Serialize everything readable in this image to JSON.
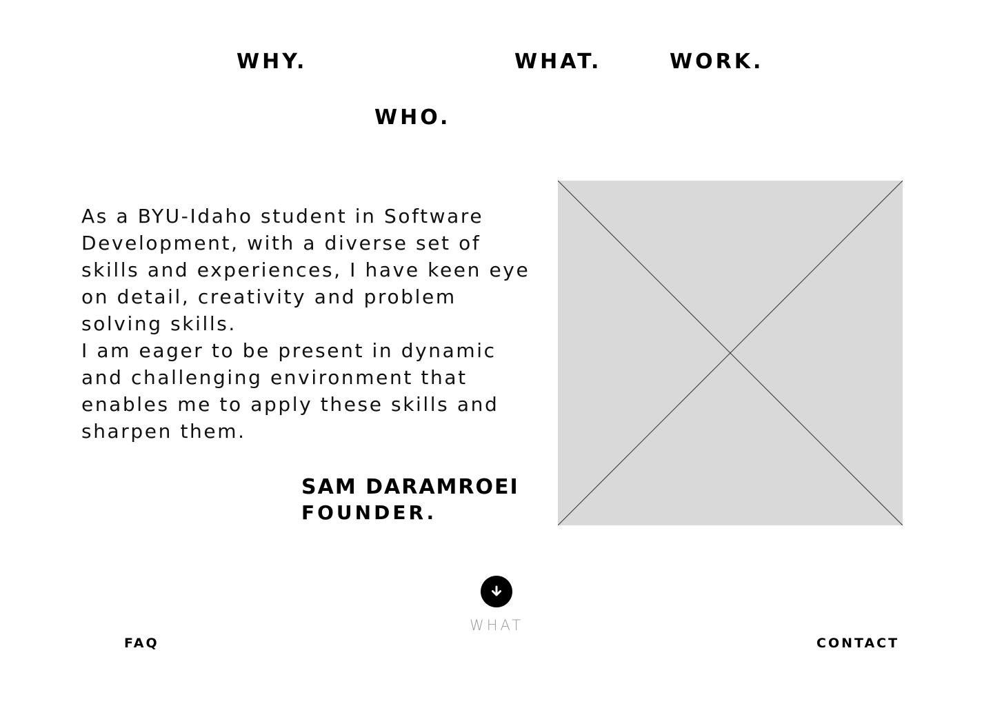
{
  "nav": {
    "why": "WHY.",
    "what": "WHAT.",
    "work": "WORK.",
    "who": "WHO."
  },
  "bio": {
    "paragraph_1": "As a BYU-Idaho student in Software Development, with a diverse set of skills and experiences, I have keen eye on detail, creativity and problem solving skills.",
    "paragraph_2": "I am eager to be present in dynamic and challenging environment that enables me to apply these skills and sharpen them."
  },
  "signature": {
    "name": "SAM DARAMROEI",
    "role": "FOUNDER."
  },
  "image_placeholder": {
    "fill_color": "#d9d9d9",
    "line_color": "#333333"
  },
  "scroll": {
    "icon": "arrow-down-icon",
    "label": "WHAT"
  },
  "footer": {
    "faq": "FAQ",
    "contact": "CONTACT"
  }
}
